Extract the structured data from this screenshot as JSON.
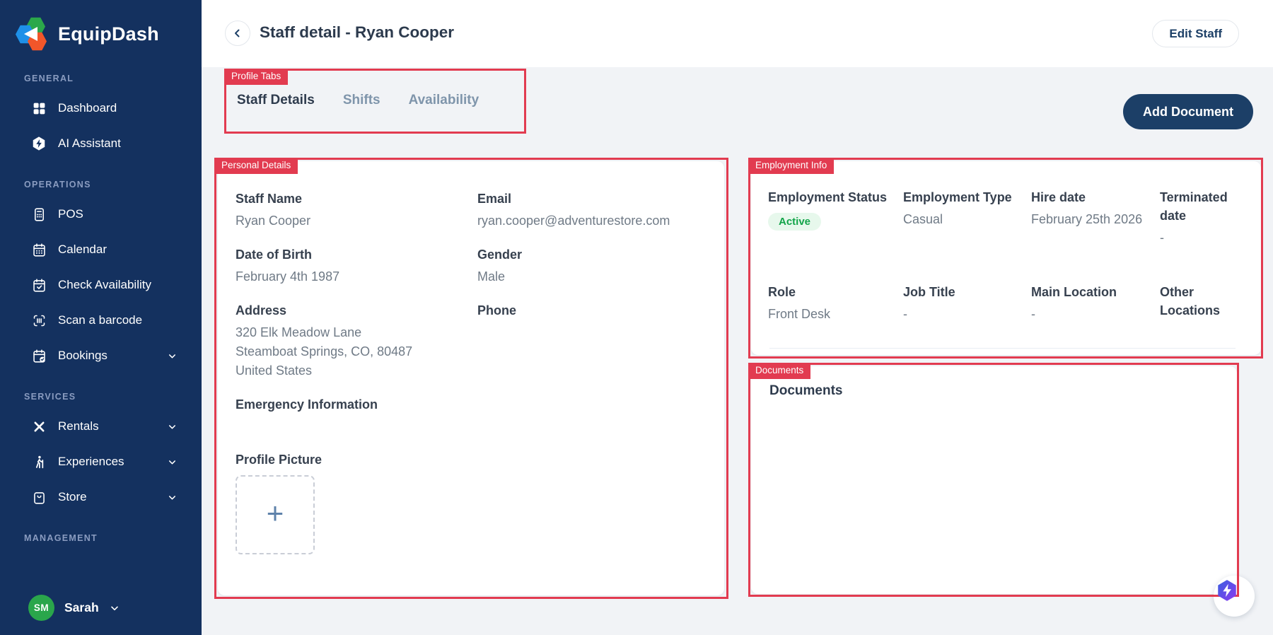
{
  "brand": {
    "name": "EquipDash"
  },
  "sidebar": {
    "sections": [
      {
        "label": "GENERAL",
        "items": [
          {
            "label": "Dashboard"
          },
          {
            "label": "AI Assistant"
          }
        ]
      },
      {
        "label": "OPERATIONS",
        "items": [
          {
            "label": "POS"
          },
          {
            "label": "Calendar"
          },
          {
            "label": "Check Availability"
          },
          {
            "label": "Scan a barcode"
          },
          {
            "label": "Bookings"
          }
        ]
      },
      {
        "label": "SERVICES",
        "items": [
          {
            "label": "Rentals"
          },
          {
            "label": "Experiences"
          },
          {
            "label": "Store"
          }
        ]
      },
      {
        "label": "MANAGEMENT",
        "items": []
      }
    ],
    "user": {
      "initials": "SM",
      "name": "Sarah"
    }
  },
  "header": {
    "title": "Staff detail - Ryan Cooper",
    "edit_staff_label": "Edit Staff"
  },
  "tabs": {
    "items": [
      {
        "label": "Staff Details"
      },
      {
        "label": "Shifts"
      },
      {
        "label": "Availability"
      }
    ]
  },
  "toolbar": {
    "add_document_label": "Add Document"
  },
  "personal_details": {
    "staff_name": {
      "label": "Staff Name",
      "value": "Ryan Cooper"
    },
    "email": {
      "label": "Email",
      "value": "ryan.cooper@adventurestore.com"
    },
    "dob": {
      "label": "Date of Birth",
      "value": "February 4th 1987"
    },
    "gender": {
      "label": "Gender",
      "value": "Male"
    },
    "address": {
      "label": "Address",
      "value": "320 Elk Meadow Lane\nSteamboat Springs, CO, 80487\nUnited States"
    },
    "phone": {
      "label": "Phone",
      "value": ""
    },
    "emergency": {
      "label": "Emergency Information",
      "value": ""
    },
    "profile_picture": {
      "label": "Profile Picture",
      "upload_glyph": "+"
    }
  },
  "employment_info": {
    "fields": [
      {
        "label": "Employment Status",
        "value": "Active"
      },
      {
        "label": "Employment Type",
        "value": "Casual"
      },
      {
        "label": "Hire date",
        "value": "February 25th 2026"
      },
      {
        "label": "Terminated date",
        "value": "-"
      },
      {
        "label": "Role",
        "value": "Front Desk"
      },
      {
        "label": "Job Title",
        "value": "-"
      },
      {
        "label": "Main Location",
        "value": "-"
      },
      {
        "label": "Other Locations",
        "value": ""
      }
    ]
  },
  "documents": {
    "title": "Documents"
  },
  "annotations": {
    "boxes": [
      {
        "label": "Profile Tabs"
      },
      {
        "label": "Personal Details"
      },
      {
        "label": "Employment Info"
      },
      {
        "label": "Documents"
      }
    ]
  },
  "colors": {
    "sidebar_navy": "#14315f",
    "primary_navy": "#1c3f67",
    "annotation_red": "#e23b50",
    "badge_green_text": "#12a449",
    "badge_green_bg": "#e7f8ec",
    "page_bg": "#f1f3f6"
  }
}
